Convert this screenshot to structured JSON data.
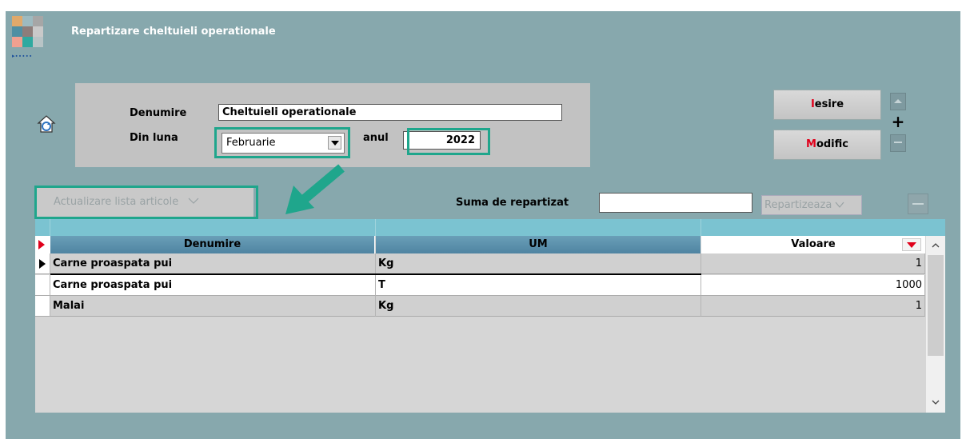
{
  "window": {
    "title": "Repartizare cheltuieli operationale"
  },
  "form": {
    "denumire_label": "Denumire",
    "denumire_value": "Cheltuieli operationale",
    "luna_label": "Din luna",
    "luna_value": "Februarie",
    "anul_label": "anul",
    "anul_value": "2022"
  },
  "buttons": {
    "iesire_first": "I",
    "iesire_rest": "esire",
    "modific_first": "M",
    "modific_rest": "odific",
    "plus": "+",
    "actualizare": "Actualizare lista articole",
    "repartizeaza": "Repartizeaza",
    "suma_label": "Suma de repartizat",
    "suma_value": ""
  },
  "table": {
    "columns": [
      "Denumire",
      "UM",
      "Valoare"
    ],
    "rows": [
      {
        "denumire": "Carne proaspata pui",
        "um": "Kg",
        "valoare": "1"
      },
      {
        "denumire": "Carne proaspata pui",
        "um": "T",
        "valoare": "1000"
      },
      {
        "denumire": "Malai",
        "um": "Kg",
        "valoare": "1"
      }
    ]
  },
  "colors": {
    "window_bg": "#87a8ad",
    "highlight": "#1fa68c",
    "header_blue": "#7bc3d1",
    "accent_red": "#e0001b"
  }
}
